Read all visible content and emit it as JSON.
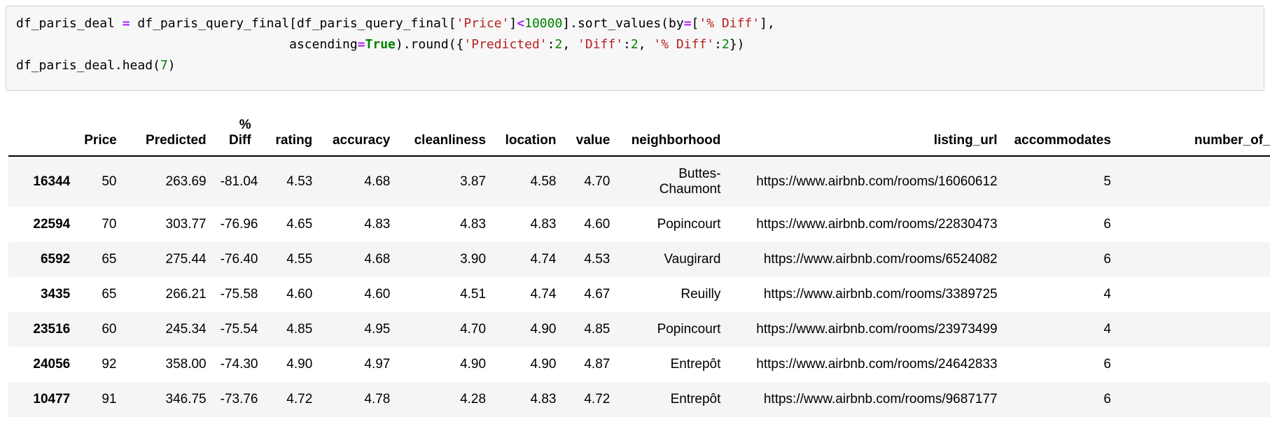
{
  "notebook": {
    "code_cell": {
      "lines": [
        [
          {
            "t": "df_paris_deal ",
            "k": "plain"
          },
          {
            "t": "=",
            "k": "op"
          },
          {
            "t": " df_paris_query_final[df_paris_query_final[",
            "k": "plain"
          },
          {
            "t": "'Price'",
            "k": "str"
          },
          {
            "t": "]",
            "k": "plain"
          },
          {
            "t": "<",
            "k": "op"
          },
          {
            "t": "10000",
            "k": "num"
          },
          {
            "t": "].sort_values(by",
            "k": "plain"
          },
          {
            "t": "=",
            "k": "op"
          },
          {
            "t": "[",
            "k": "plain"
          },
          {
            "t": "'% Diff'",
            "k": "str"
          },
          {
            "t": "],",
            "k": "plain"
          }
        ],
        [
          {
            "t": "                                    ascending",
            "k": "plain"
          },
          {
            "t": "=",
            "k": "op"
          },
          {
            "t": "True",
            "k": "kw"
          },
          {
            "t": ").round({",
            "k": "plain"
          },
          {
            "t": "'Predicted'",
            "k": "str"
          },
          {
            "t": ":",
            "k": "plain"
          },
          {
            "t": "2",
            "k": "num"
          },
          {
            "t": ", ",
            "k": "plain"
          },
          {
            "t": "'Diff'",
            "k": "str"
          },
          {
            "t": ":",
            "k": "plain"
          },
          {
            "t": "2",
            "k": "num"
          },
          {
            "t": ", ",
            "k": "plain"
          },
          {
            "t": "'% Diff'",
            "k": "str"
          },
          {
            "t": ":",
            "k": "plain"
          },
          {
            "t": "2",
            "k": "num"
          },
          {
            "t": "})",
            "k": "plain"
          }
        ],
        [
          {
            "t": "df_paris_deal.head(",
            "k": "plain"
          },
          {
            "t": "7",
            "k": "num"
          },
          {
            "t": ")",
            "k": "plain"
          }
        ]
      ]
    }
  },
  "dataframe": {
    "index_header": "",
    "columns": [
      "Price",
      "Predicted",
      "% Diff",
      "rating",
      "accuracy",
      "cleanliness",
      "location",
      "value",
      "neighborhood",
      "listing_url",
      "accommodates",
      "number_of_r"
    ],
    "rows": [
      {
        "index": "16344",
        "Price": "50",
        "Predicted": "263.69",
        "pct_diff": "-81.04",
        "rating": "4.53",
        "accuracy": "4.68",
        "cleanliness": "3.87",
        "location": "4.58",
        "value": "4.70",
        "neighborhood": "Buttes-Chaumont",
        "listing_url": "https://www.airbnb.com/rooms/16060612",
        "accommodates": "5",
        "number_of_r": ""
      },
      {
        "index": "22594",
        "Price": "70",
        "Predicted": "303.77",
        "pct_diff": "-76.96",
        "rating": "4.65",
        "accuracy": "4.83",
        "cleanliness": "4.83",
        "location": "4.83",
        "value": "4.60",
        "neighborhood": "Popincourt",
        "listing_url": "https://www.airbnb.com/rooms/22830473",
        "accommodates": "6",
        "number_of_r": ""
      },
      {
        "index": "6592",
        "Price": "65",
        "Predicted": "275.44",
        "pct_diff": "-76.40",
        "rating": "4.55",
        "accuracy": "4.68",
        "cleanliness": "3.90",
        "location": "4.74",
        "value": "4.53",
        "neighborhood": "Vaugirard",
        "listing_url": "https://www.airbnb.com/rooms/6524082",
        "accommodates": "6",
        "number_of_r": ""
      },
      {
        "index": "3435",
        "Price": "65",
        "Predicted": "266.21",
        "pct_diff": "-75.58",
        "rating": "4.60",
        "accuracy": "4.60",
        "cleanliness": "4.51",
        "location": "4.74",
        "value": "4.67",
        "neighborhood": "Reuilly",
        "listing_url": "https://www.airbnb.com/rooms/3389725",
        "accommodates": "4",
        "number_of_r": ""
      },
      {
        "index": "23516",
        "Price": "60",
        "Predicted": "245.34",
        "pct_diff": "-75.54",
        "rating": "4.85",
        "accuracy": "4.95",
        "cleanliness": "4.70",
        "location": "4.90",
        "value": "4.85",
        "neighborhood": "Popincourt",
        "listing_url": "https://www.airbnb.com/rooms/23973499",
        "accommodates": "4",
        "number_of_r": ""
      },
      {
        "index": "24056",
        "Price": "92",
        "Predicted": "358.00",
        "pct_diff": "-74.30",
        "rating": "4.90",
        "accuracy": "4.97",
        "cleanliness": "4.90",
        "location": "4.90",
        "value": "4.87",
        "neighborhood": "Entrepôt",
        "listing_url": "https://www.airbnb.com/rooms/24642833",
        "accommodates": "6",
        "number_of_r": ""
      },
      {
        "index": "10477",
        "Price": "91",
        "Predicted": "346.75",
        "pct_diff": "-73.76",
        "rating": "4.72",
        "accuracy": "4.78",
        "cleanliness": "4.28",
        "location": "4.83",
        "value": "4.72",
        "neighborhood": "Entrepôt",
        "listing_url": "https://www.airbnb.com/rooms/9687177",
        "accommodates": "6",
        "number_of_r": ""
      }
    ]
  },
  "colors": {
    "cell_background": "#f7f7f7",
    "cell_border": "#cfcfcf",
    "row_stripe": "#f5f5f5",
    "string_token": "#ba2121",
    "number_token": "#008000",
    "operator_token": "#aa22ff",
    "keyword_token": "#008000"
  }
}
